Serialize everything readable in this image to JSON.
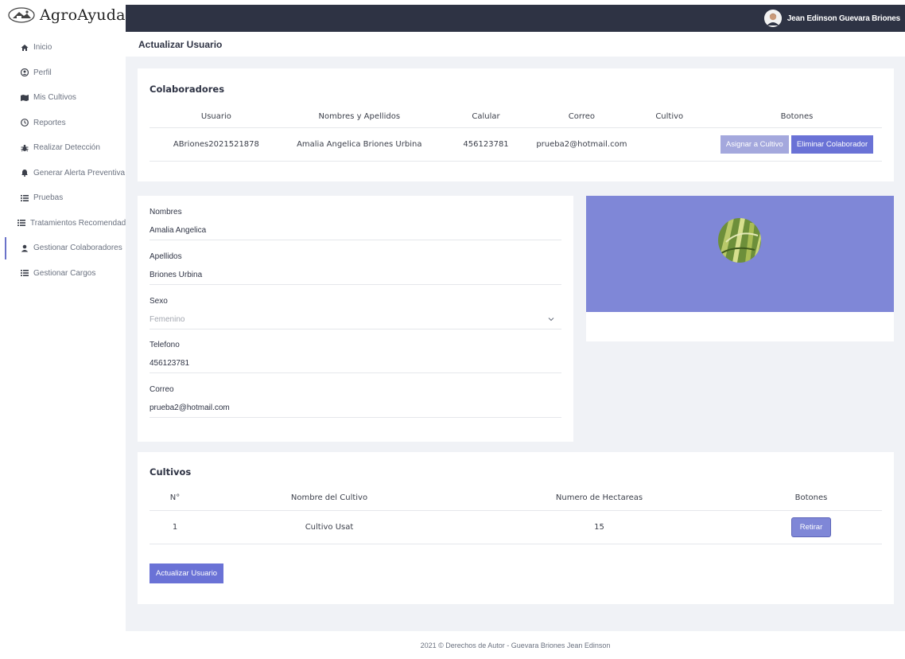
{
  "brand": {
    "name": "AgroAyuda"
  },
  "sidebar": {
    "items": [
      {
        "label": "Inicio",
        "icon": "home-icon"
      },
      {
        "label": "Perfil",
        "icon": "user-circle-icon"
      },
      {
        "label": "Mis Cultivos",
        "icon": "map-icon"
      },
      {
        "label": "Reportes",
        "icon": "clock-icon"
      },
      {
        "label": "Realizar Detección",
        "icon": "bug-icon"
      },
      {
        "label": "Generar Alerta Preventiva",
        "icon": "bell-icon"
      },
      {
        "label": "Pruebas",
        "icon": "list-icon"
      },
      {
        "label": "Tratamientos Recomendados",
        "icon": "list-icon"
      },
      {
        "label": "Gestionar Colaboradores",
        "icon": "user-icon"
      },
      {
        "label": "Gestionar Cargos",
        "icon": "list-icon"
      }
    ],
    "active_index": 8
  },
  "topbar": {
    "user_name": "Jean Edinson Guevara Briones"
  },
  "page": {
    "title": "Actualizar Usuario"
  },
  "collaborators": {
    "title": "Colaboradores",
    "columns": [
      "Usuario",
      "Nombres y Apellidos",
      "Calular",
      "Correo",
      "Cultivo",
      "Botones"
    ],
    "rows": [
      {
        "usuario": "ABriones2021521878",
        "nombres": "Amalia Angelica Briones Urbina",
        "celular": "456123781",
        "correo": "prueba2@hotmail.com",
        "cultivo": "",
        "assign_label": "Asignar a Cultivo",
        "delete_label": "Eliminar Colaborador"
      }
    ]
  },
  "form": {
    "nombres_label": "Nombres",
    "nombres_value": "Amalia Angelica",
    "apellidos_label": "Apellidos",
    "apellidos_value": "Briones Urbina",
    "sexo_label": "Sexo",
    "sexo_value": "Femenino",
    "telefono_label": "Telefono",
    "telefono_value": "456123781",
    "correo_label": "Correo",
    "correo_value": "prueba2@hotmail.com"
  },
  "cultivos": {
    "title": "Cultivos",
    "columns": [
      "N°",
      "Nombre del Cultivo",
      "Numero de Hectareas",
      "Botones"
    ],
    "rows": [
      {
        "n": "1",
        "nombre": "Cultivo Usat",
        "hectareas": "15",
        "remove_label": "Retirar"
      }
    ],
    "update_label": "Actualizar Usuario"
  },
  "footer": {
    "text": "2021 © Derechos de Autor - Guevara Briones Jean Edinson"
  },
  "colors": {
    "topbar": "#2e3344",
    "accent": "#6a72d6",
    "banner": "#7f87d7",
    "background": "#f0f2f6"
  }
}
